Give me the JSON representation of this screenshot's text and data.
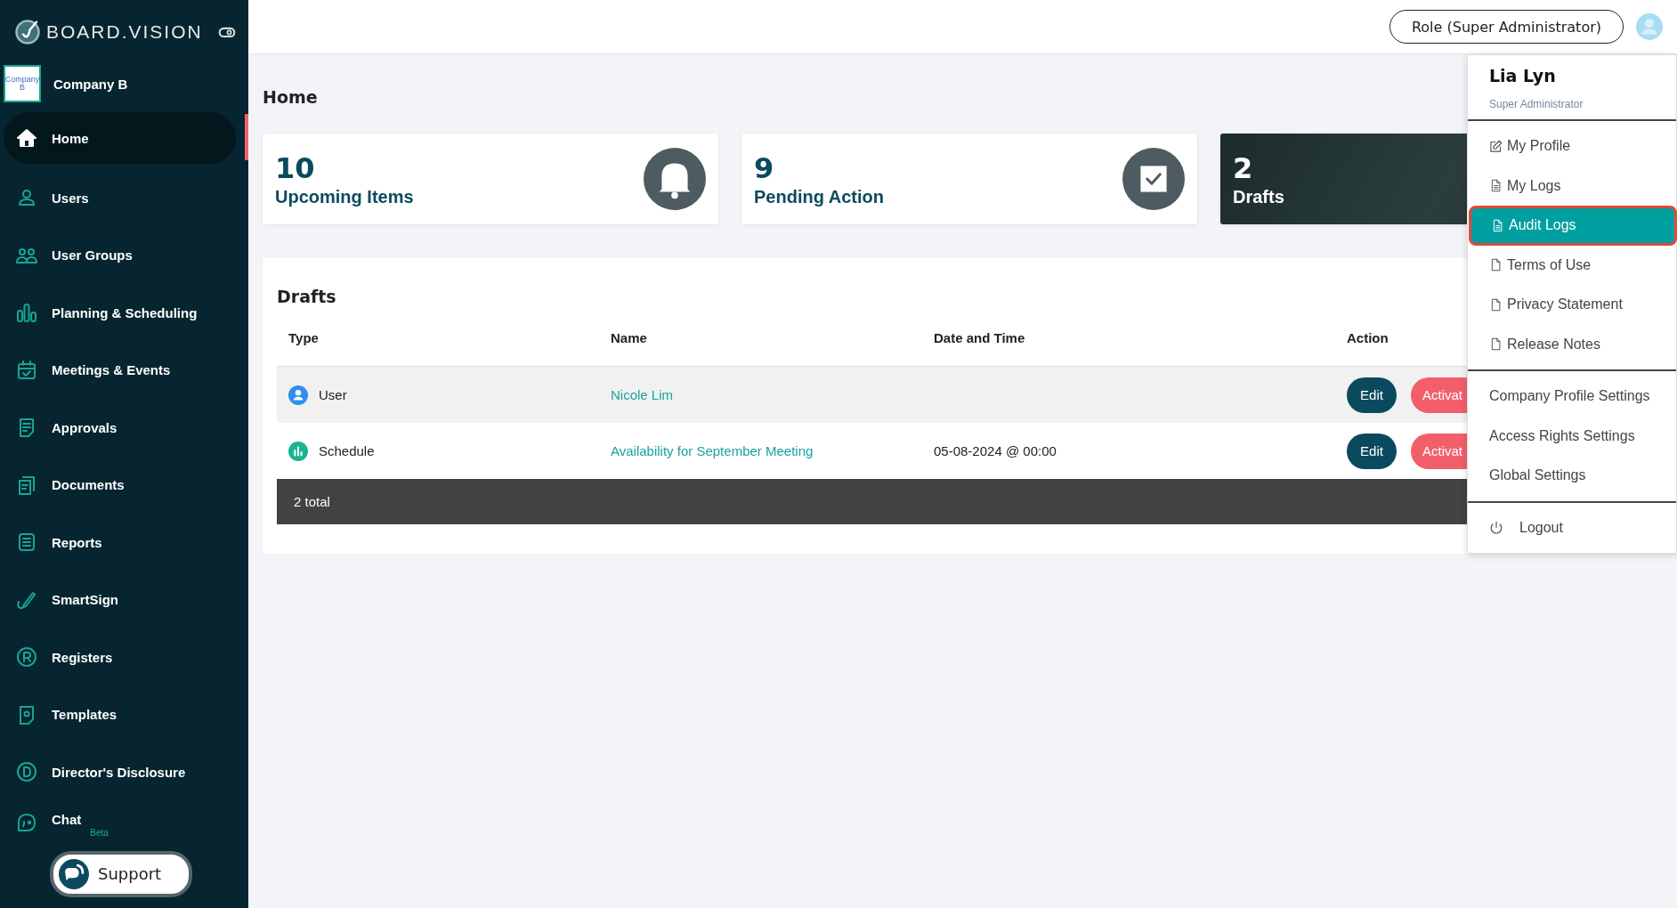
{
  "sidebar": {
    "brand": "BOARD.VISION",
    "company": {
      "logo_text": "Company B",
      "name": "Company B"
    },
    "items": [
      {
        "label": "Home",
        "selected": true
      },
      {
        "label": "Users",
        "selected": false
      },
      {
        "label": "User Groups",
        "selected": false
      },
      {
        "label": "Planning & Scheduling",
        "selected": false
      },
      {
        "label": "Meetings & Events",
        "selected": false
      },
      {
        "label": "Approvals",
        "selected": false
      },
      {
        "label": "Documents",
        "selected": false
      },
      {
        "label": "Reports",
        "selected": false
      },
      {
        "label": "SmartSign",
        "selected": false
      },
      {
        "label": "Registers",
        "selected": false
      },
      {
        "label": "Templates",
        "selected": false
      },
      {
        "label": "Director's Disclosure",
        "selected": false
      },
      {
        "label": "Chat",
        "selected": false,
        "badge": "Beta"
      }
    ],
    "support_button": "Support"
  },
  "top_bar": {
    "role_button": "Role (Super Administrator)"
  },
  "page_title": "Home",
  "cards": [
    {
      "count": "10",
      "label": "Upcoming Items",
      "kind": "bell"
    },
    {
      "count": "9",
      "label": "Pending Action",
      "kind": "check"
    },
    {
      "count": "2",
      "label": "Drafts",
      "kind": "dark"
    }
  ],
  "drafts": {
    "title": "Drafts",
    "columns": [
      "Type",
      "Name",
      "Date and Time",
      "Action"
    ],
    "rows": [
      {
        "type": "User",
        "kind": "user",
        "name": "Nicole Lim",
        "datetime": "",
        "buttons": [
          "Edit",
          "Activat"
        ]
      },
      {
        "type": "Schedule",
        "kind": "schedule",
        "name": "Availability for September Meeting",
        "datetime": "05-08-2024 @ 00:00",
        "buttons": [
          "Edit",
          "Activat"
        ]
      }
    ],
    "footer": "2 total"
  },
  "user_menu": {
    "name": "Lia Lyn",
    "role": "Super Administrator",
    "groups": [
      [
        {
          "label": "My Profile",
          "selected": false
        },
        {
          "label": "My Logs",
          "selected": false
        },
        {
          "label": "Audit Logs",
          "selected": true
        },
        {
          "label": "Terms of Use",
          "selected": false
        },
        {
          "label": "Privacy Statement",
          "selected": false
        },
        {
          "label": "Release Notes",
          "selected": false
        }
      ],
      [
        {
          "label": "Company Profile Settings",
          "selected": false
        },
        {
          "label": "Access Rights Settings",
          "selected": false
        },
        {
          "label": "Global Settings",
          "selected": false
        }
      ],
      [
        {
          "label": "Logout",
          "selected": false
        }
      ]
    ]
  }
}
